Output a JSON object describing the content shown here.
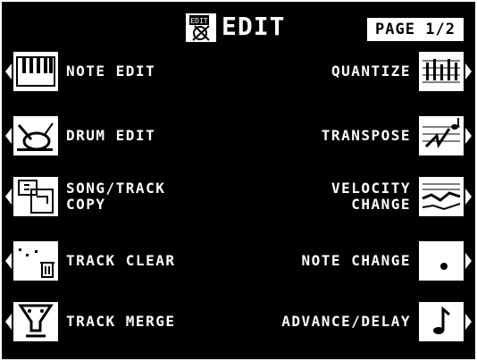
{
  "header": {
    "title": "EDIT",
    "page_indicator": "PAGE 1/2",
    "icon": "edit-icon",
    "icon_text": "EDIT"
  },
  "left_items": [
    {
      "label": "NOTE EDIT",
      "icon": "keyboard-icon"
    },
    {
      "label": "DRUM EDIT",
      "icon": "drum-icon"
    },
    {
      "label_lines": [
        "SONG/TRACK",
        "COPY"
      ],
      "icon": "copy-icon"
    },
    {
      "label": "TRACK CLEAR",
      "icon": "trash-icon"
    },
    {
      "label": "TRACK MERGE",
      "icon": "funnel-icon"
    }
  ],
  "right_items": [
    {
      "label": "QUANTIZE",
      "icon": "quantize-icon"
    },
    {
      "label": "TRANSPOSE",
      "icon": "transpose-icon"
    },
    {
      "label_lines": [
        "VELOCITY",
        "CHANGE"
      ],
      "icon": "velocity-icon"
    },
    {
      "label": "NOTE CHANGE",
      "icon": "note-change-icon"
    },
    {
      "label": "ADVANCE/DELAY",
      "icon": "note-icon"
    }
  ]
}
